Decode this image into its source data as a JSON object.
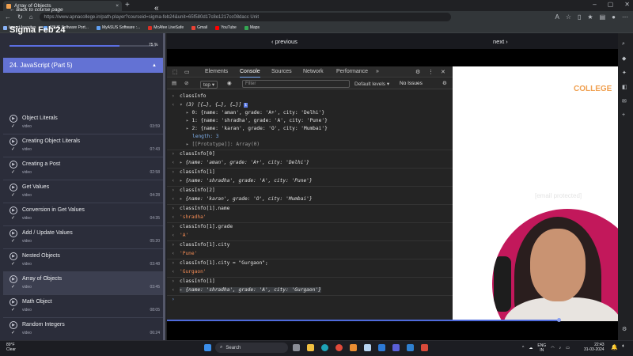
{
  "browser": {
    "tab_title": "Array of Objects",
    "tab_close": "×",
    "new_tab": "+",
    "url": "https://www.apnacollege.in/path-player?courseid=sigma-feb24&unit=65f580d17c8e1217cc08dacc Unit",
    "bookmarks": [
      "Import favorites",
      "ASUS Software Port...",
      "MyASUS Software :...",
      "McAfee LiveSafe",
      "Gmail",
      "YouTube",
      "Maps"
    ]
  },
  "sidebar": {
    "back_label": "Back to course page",
    "collapse_icon": "«",
    "course_title": "Sigma Feb'24",
    "progress": 0.75,
    "progress_label": "75 %",
    "section_title": "24. JavaScript (Part 5)",
    "items": [
      {
        "title": "Object Literals",
        "sub": "video",
        "dur": "03:59"
      },
      {
        "title": "Creating Object Literals",
        "sub": "video",
        "dur": "07:43"
      },
      {
        "title": "Creating a Post",
        "sub": "video",
        "dur": "02:58"
      },
      {
        "title": "Get Values",
        "sub": "video",
        "dur": "04:28"
      },
      {
        "title": "Conversion in Get Values",
        "sub": "video",
        "dur": "04:35"
      },
      {
        "title": "Add / Update Values",
        "sub": "video",
        "dur": "05:20"
      },
      {
        "title": " Nested Objects",
        "sub": "video",
        "dur": "03:48"
      },
      {
        "title": "Array of Objects",
        "sub": "video",
        "dur": "03:45"
      },
      {
        "title": "Math Object",
        "sub": "video",
        "dur": "08:05"
      },
      {
        "title": "Random Integers",
        "sub": "video",
        "dur": "06:24"
      }
    ]
  },
  "video_nav": {
    "prev": "‹ previous",
    "next": "next ›",
    "progress": 0.87
  },
  "devtools": {
    "tabs": [
      "Elements",
      "Console",
      "Sources",
      "Network",
      "Performance",
      "»"
    ],
    "context": "top ▾",
    "filter_placeholder": "Filter",
    "default_levels": "Default levels ▾",
    "no_issues": "No Issues",
    "console": {
      "l1": "classInfo",
      "l2": "(3) [{…}, {…}, {…}]",
      "l3": "0: {name: 'aman', grade: 'A+', city: 'Delhi'}",
      "l4": "1: {name: 'shradha', grade: 'A', city: 'Pune'}",
      "l5": "2: {name: 'karan', grade: 'O', city: 'Mumbai'}",
      "l6": "length: 3",
      "l7": "[[Prototype]]: Array(0)",
      "l8": "classInfo[0]",
      "l9": "{name: 'aman', grade: 'A+', city: 'Delhi'}",
      "l10": "classInfo[1]",
      "l11": "{name: 'shradha', grade: 'A', city: 'Pune'}",
      "l12": "classInfo[2]",
      "l13": "{name: 'karan', grade: 'O', city: 'Mumbai'}",
      "l14": "classInfo[1].name",
      "l15": "'shradha'",
      "l16": "classInfo[1].grade",
      "l17": "'A'",
      "l18": "classInfo[1].city",
      "l19": "'Pune'",
      "l20": "classInfo[1].city = \"Gurgaon\";",
      "l21": "'Gurgaon'",
      "l22": "classInfo[1]",
      "l23": "{name: 'shradha', grade: 'A', city: 'Gurgaon'}"
    }
  },
  "slide": {
    "logo": "COLLEGE",
    "email": "[email protected]"
  },
  "taskbar": {
    "weather_temp": "89°F",
    "weather_desc": "Clear",
    "search_label": "Search",
    "lang": "ENG",
    "region": "IN",
    "time": "22:43",
    "date": "31-03-2024"
  },
  "colors": {
    "accent": "#6372d4",
    "progress": "#5b6ee1",
    "string": "#f28b54",
    "key": "#7fb0ec",
    "slide_circle": "#c2185b"
  }
}
